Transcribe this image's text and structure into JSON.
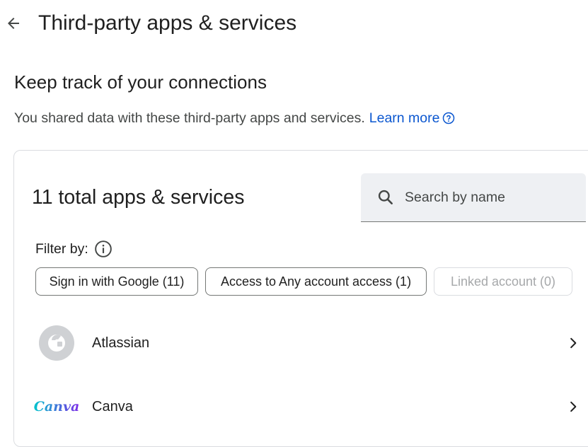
{
  "header": {
    "title": "Third-party apps & services",
    "back_icon": "arrow-left-icon"
  },
  "intro": {
    "heading": "Keep track of your connections",
    "description": "You shared data with these third-party apps and services.",
    "learn_more": "Learn more",
    "help_icon": "help-circle-icon"
  },
  "apps_panel": {
    "total_label": "11 total apps & services",
    "search": {
      "placeholder": "Search by name",
      "value": "",
      "icon": "search-icon"
    },
    "filter_label": "Filter by:",
    "filter_info_icon": "info-icon",
    "chips": [
      {
        "label": "Sign in with Google (11)",
        "enabled": true
      },
      {
        "label": "Access to Any account access (1)",
        "enabled": true
      },
      {
        "label": "Linked account (0)",
        "enabled": false
      }
    ],
    "apps": [
      {
        "name": "Atlassian",
        "logo": "atlassian-logo"
      },
      {
        "name": "Canva",
        "logo_text": "Canva"
      }
    ]
  },
  "colors": {
    "link": "#0b57d0",
    "text_primary": "#1f1f1f",
    "text_secondary": "#444746",
    "search_bg": "#eef0f3",
    "border": "#dadce0"
  }
}
